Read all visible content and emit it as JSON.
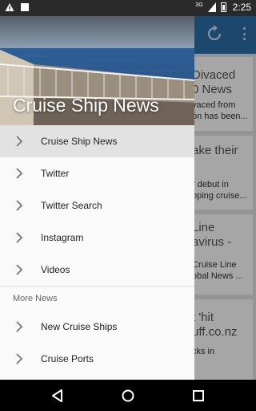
{
  "status_bar": {
    "time": "2:25",
    "network": "3G",
    "icons": [
      "warning-icon",
      "notification-square-icon",
      "signal-icon",
      "battery-icon"
    ]
  },
  "app_bar": {
    "actions": [
      "refresh-icon",
      "more-vert-icon"
    ],
    "color": "#2b6fa8"
  },
  "background_cards": [
    {
      "title": "Divaced",
      "title2": "0 News",
      "snippet": "vaced from",
      "snippet2": "on has been..."
    },
    {
      "title": "ake their",
      "snippet": "r debut in",
      "snippet2": "oping cruise..."
    },
    {
      "title": "Line",
      "title2": "avirus -",
      "snippet": "Cruise Line",
      "snippet2": "obal News ..."
    },
    {
      "title": "t 'hit",
      "title2": "uff.co.nz",
      "snippet": "cks in"
    }
  ],
  "drawer": {
    "title": "Cruise Ship News",
    "items": [
      {
        "label": "Cruise Ship News",
        "active": true
      },
      {
        "label": "Twitter",
        "active": false
      },
      {
        "label": "Twitter Search",
        "active": false
      },
      {
        "label": "Instagram",
        "active": false
      },
      {
        "label": "Videos",
        "active": false
      }
    ],
    "section_header": "More News",
    "more_items": [
      {
        "label": "New Cruise Ships"
      },
      {
        "label": "Cruise Ports"
      }
    ]
  },
  "nav_bar": {
    "buttons": [
      "back-icon",
      "home-icon",
      "recents-icon"
    ]
  }
}
